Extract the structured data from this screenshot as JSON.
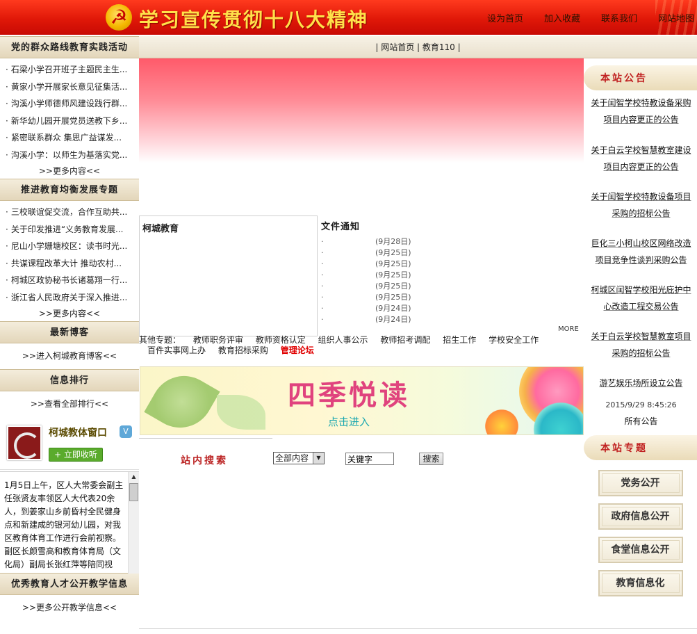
{
  "header": {
    "title": "学习宣传贯彻十八大精神",
    "links": [
      "设为首页",
      "加入收藏",
      "联系我们",
      "网站地图"
    ]
  },
  "nav": {
    "text": "| 网站首页 | 教育110 |"
  },
  "left": {
    "section1": {
      "title": "党的群众路线教育实践活动",
      "items": [
        "石梁小学召开班子主题民主生...",
        "黄家小学开展家长意见征集活...",
        "沟溪小学师德师风建设践行群...",
        "新华幼儿园开展党员送教下乡...",
        "紧密联系群众 集思广益谋发...",
        "沟溪小学：以师生为基落实党..."
      ],
      "more": ">>更多内容<<"
    },
    "section2": {
      "title": "推进教育均衡发展专题",
      "items": [
        "三校联谊促交流，合作互助共...",
        "关于印发推进“义务教育发展...",
        "尼山小学姗塘校区：读书时光...",
        "共谋课程改革大计 推动农村...",
        "柯城区政协秘书长诸葛翔一行...",
        "浙江省人民政府关于深入推进..."
      ],
      "more": ">>更多内容<<"
    },
    "blog": {
      "title": "最新博客",
      "link": ">>进入柯城教育博客<<"
    },
    "rank": {
      "title": "信息排行",
      "link": ">>查看全部排行<<"
    },
    "weibo": {
      "name": "柯城教体窗口",
      "v": "V",
      "follow": "+ 立即收听"
    },
    "scroll_text": "1月5日上午，区人大常委会副主任张贤友率领区人大代表20余人，到姜家山乡前昏村全民健身点和新建成的银河幼儿园，对我区教育体育工作进行会前视察。副区长颜雪高和教育体育局（文化局）副局长张红萍等陪同视察。",
    "teaching": {
      "title": "优秀教育人才公开教学信息",
      "link": ">>更多公开教学信息<<"
    }
  },
  "center": {
    "kecheng_title": "柯城教育",
    "wenjian": {
      "title": "文件通知",
      "items": [
        {
          "dot": "·",
          "date": "(9月28日)"
        },
        {
          "dot": "·",
          "date": "(9月25日)"
        },
        {
          "dot": "·",
          "date": "(9月25日)"
        },
        {
          "dot": "·",
          "date": "(9月25日)"
        },
        {
          "dot": "·",
          "date": "(9月25日)"
        },
        {
          "dot": "·",
          "date": "(9月25日)"
        },
        {
          "dot": "·",
          "date": "(9月24日)"
        },
        {
          "dot": "·",
          "date": "(9月24日)"
        }
      ],
      "more": "MORE"
    },
    "topics": {
      "label": "其他专题：",
      "row1": [
        "教师职务评审",
        "教师资格认定",
        "组织人事公示",
        "教师招考调配",
        "招生工作",
        "学校安全工作"
      ],
      "row2": [
        "百件实事网上办",
        "教育招标采购"
      ],
      "highlight": "管理论坛"
    },
    "reading": {
      "title": "四季悦读",
      "subtitle": "点击进入"
    },
    "search": {
      "title": "站内搜索",
      "select_value": "全部内容",
      "input_value": "关键字",
      "button": "搜索"
    }
  },
  "right": {
    "notice_title": "本站公告",
    "notices": [
      "关于闰智学校特教设备采购项目内容更正的公告",
      "关于白云学校智慧教室建设项目内容更正的公告",
      "关于闰智学校特教设备项目采购的招标公告",
      "巨化三小柯山校区网络改造项目竞争性谈判采购公告",
      "柯城区闰智学校阳光庇护中心改造工程交易公告",
      "关于白云学校智慧教室项目采购的招标公告",
      "游艺娱乐场所设立公告"
    ],
    "post_time": "2015/9/29 8:45:26",
    "all_notice": "所有公告",
    "zhuanti_title": "本站专题",
    "zhuanti": [
      "党务公开",
      "政府信息公开",
      "食堂信息公开",
      "教育信息化"
    ]
  },
  "colors": {
    "header_red": "#e01808",
    "title_gold": "#ffe14a",
    "accent_red": "#c02020",
    "beige": "#e3d6ba"
  }
}
